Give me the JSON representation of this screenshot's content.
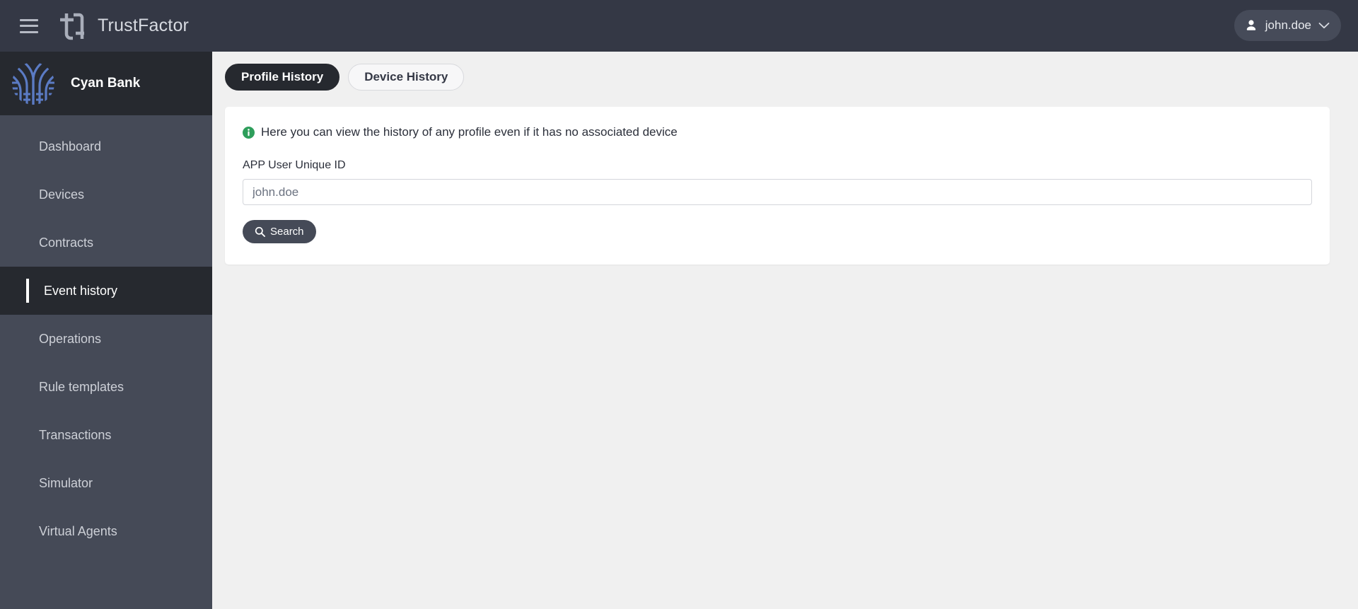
{
  "header": {
    "menu_icon": "hamburger-icon",
    "logo_icon": "trustfactor-logo-icon",
    "app_title": "TrustFactor",
    "user": {
      "name": "john.doe",
      "avatar_icon": "person-icon",
      "chevron_icon": "chevron-down-icon"
    }
  },
  "sidebar": {
    "org": {
      "logo_icon": "cyan-bank-logo-icon",
      "name": "Cyan Bank"
    },
    "items": [
      {
        "label": "Dashboard",
        "active": false
      },
      {
        "label": "Devices",
        "active": false
      },
      {
        "label": "Contracts",
        "active": false
      },
      {
        "label": "Event history",
        "active": true
      },
      {
        "label": "Operations",
        "active": false
      },
      {
        "label": "Rule templates",
        "active": false
      },
      {
        "label": "Transactions",
        "active": false
      },
      {
        "label": "Simulator",
        "active": false
      },
      {
        "label": "Virtual Agents",
        "active": false
      }
    ]
  },
  "main": {
    "tabs": [
      {
        "label": "Profile History",
        "active": true
      },
      {
        "label": "Device History",
        "active": false
      }
    ],
    "notice": {
      "icon": "info-circle-icon",
      "text": "Here you can view the history of any profile even if it has no associated device"
    },
    "form": {
      "label": "APP User Unique ID",
      "input_value": "",
      "input_placeholder": "john.doe",
      "search_button": {
        "label": "Search",
        "icon": "search-icon"
      }
    }
  },
  "colors": {
    "header_bg": "#343845",
    "sidebar_bg": "#454a57",
    "sidebar_active_bg": "#26292f",
    "page_bg": "#f0f0f0",
    "card_bg": "#ffffff",
    "accent_dark": "#26292f",
    "info_green": "#2e9e5b",
    "org_logo_blue": "#5b7bc4"
  }
}
